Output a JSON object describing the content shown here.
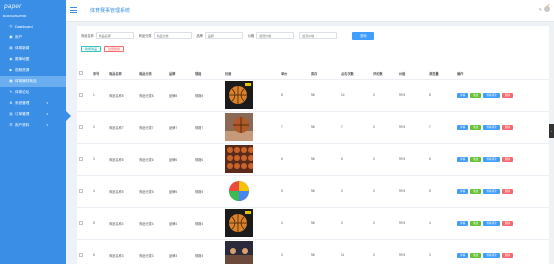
{
  "app": {
    "logo": "paper",
    "header_title": "体育赛事管理系统",
    "nav_title": "MAIN NAVIGATION"
  },
  "sidebar": {
    "items": [
      {
        "label": "Dashboard",
        "icon": "dashboard-icon",
        "has_children": false
      },
      {
        "label": "用户",
        "icon": "user-icon",
        "has_children": false
      },
      {
        "label": "体育新闻",
        "icon": "news-icon",
        "has_children": false
      },
      {
        "label": "赛事地图",
        "icon": "location-icon",
        "has_children": false
      },
      {
        "label": "视频资源",
        "icon": "video-icon",
        "has_children": false
      },
      {
        "label": "体育器材商品",
        "icon": "shop-icon",
        "has_children": false,
        "active": true
      },
      {
        "label": "体育论坛",
        "icon": "forum-icon",
        "has_children": false
      },
      {
        "label": "系统管理",
        "icon": "settings-icon",
        "has_children": true
      },
      {
        "label": "订单管理",
        "icon": "order-icon",
        "has_children": true
      },
      {
        "label": "用户资料",
        "icon": "profile-icon",
        "has_children": true
      }
    ]
  },
  "search": {
    "fields": [
      {
        "label": "商品名称",
        "placeholder": "商品名称"
      },
      {
        "label": "商品分类",
        "placeholder": "商品分类"
      },
      {
        "label": "品牌",
        "placeholder": "品牌"
      },
      {
        "label": "价格",
        "placeholder": "最低价格"
      }
    ],
    "price_max_placeholder": "最高价格",
    "search_label": "查询"
  },
  "actions": {
    "add_label": "新增商品",
    "delete_label": "批量删除"
  },
  "table": {
    "headers": [
      "",
      "序号",
      "商品名称",
      "商品分类",
      "品牌",
      "规格",
      "封面",
      "单价",
      "库存",
      "点击次数",
      "评论数",
      "价格",
      "浏览量",
      "操作"
    ],
    "rows": [
      {
        "index": "1",
        "name": "商品名称8",
        "category": "商品分类8",
        "brand": "品牌8",
        "spec": "规格8",
        "image": "basketball-dark",
        "unit": "8",
        "stock": "98",
        "clicks": "14",
        "comments": "0",
        "price": "99.9",
        "views": "8"
      },
      {
        "index": "2",
        "name": "商品名称7",
        "category": "商品分类7",
        "brand": "品牌7",
        "spec": "规格7",
        "image": "basketball-court",
        "unit": "7",
        "stock": "98",
        "clicks": "7",
        "comments": "0",
        "price": "99.9",
        "views": "7"
      },
      {
        "index": "3",
        "name": "商品名称6",
        "category": "商品分类6",
        "brand": "品牌6",
        "spec": "规格6",
        "image": "ball-rack",
        "unit": "6",
        "stock": "98",
        "clicks": "6",
        "comments": "0",
        "price": "99.9",
        "views": "6"
      },
      {
        "index": "4",
        "name": "商品名称5",
        "category": "商品分类5",
        "brand": "品牌5",
        "spec": "规格5",
        "image": "colorful-ball",
        "unit": "5",
        "stock": "98",
        "clicks": "0",
        "comments": "0",
        "price": "99.9",
        "views": "5"
      },
      {
        "index": "5",
        "name": "商品名称4",
        "category": "商品分类4",
        "brand": "品牌4",
        "spec": "规格4",
        "image": "basketball-dark",
        "unit": "4",
        "stock": "98",
        "clicks": "0",
        "comments": "0",
        "price": "99.9",
        "views": "4"
      },
      {
        "index": "6",
        "name": "商品名称3",
        "category": "商品分类3",
        "brand": "品牌3",
        "spec": "规格3",
        "image": "crowd",
        "unit": "3",
        "stock": "98",
        "clicks": "11",
        "comments": "0",
        "price": "99.9",
        "views": "3"
      }
    ],
    "ops": {
      "detail": "详情",
      "edit": "修改",
      "review": "查看评论",
      "delete": "删除"
    }
  },
  "colors": {
    "sidebar": "#3a8ee6",
    "primary": "#409eff",
    "success": "#67c23a",
    "danger": "#f56c6c"
  }
}
